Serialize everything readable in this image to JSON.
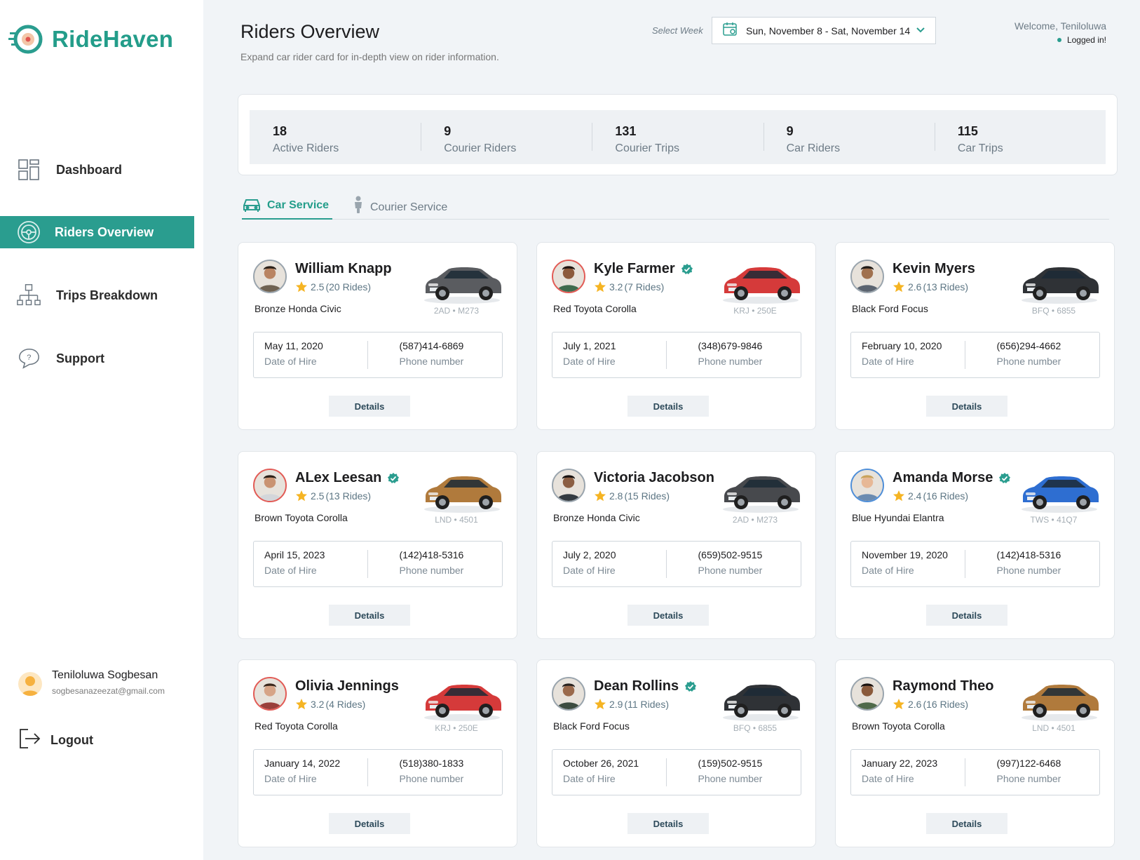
{
  "app": {
    "name": "RideHaven"
  },
  "sidebar": {
    "items": [
      {
        "label": "Dashboard",
        "icon": "dashboard-icon"
      },
      {
        "label": "Riders Overview",
        "icon": "steering-wheel-icon",
        "active": true
      },
      {
        "label": "Trips Breakdown",
        "icon": "hierarchy-icon"
      },
      {
        "label": "Support",
        "icon": "support-chat-icon"
      }
    ],
    "user": {
      "name": "Teniloluwa Sogbesan",
      "email": "sogbesanazeezat@gmail.com"
    },
    "logout_label": "Logout"
  },
  "header": {
    "title": "Riders Overview",
    "subtitle": "Expand car rider card for in-depth view on rider information.",
    "week_label": "Select Week",
    "week_value": "Sun, November 8 - Sat, November 14",
    "welcome": "Welcome, Teniloluwa",
    "status": "Logged in!"
  },
  "stats": [
    {
      "value": "18",
      "label": "Active Riders"
    },
    {
      "value": "9",
      "label": "Courier Riders"
    },
    {
      "value": "131",
      "label": "Courier Trips"
    },
    {
      "value": "9",
      "label": "Car Riders"
    },
    {
      "value": "115",
      "label": "Car Trips"
    }
  ],
  "tabs": [
    {
      "label": "Car Service",
      "active": true
    },
    {
      "label": "Courier Service",
      "active": false
    }
  ],
  "labels": {
    "date_of_hire": "Date of Hire",
    "phone_number": "Phone number",
    "details": "Details"
  },
  "riders": [
    {
      "name": "William Knapp",
      "verified": false,
      "rating": "2.5",
      "rides": "(20 Rides)",
      "car": "Bronze Honda Civic",
      "plate": "2AD • M273",
      "hire_date": "May 11, 2020",
      "phone": "(587)414-6869",
      "car_color": "#5a5c60"
    },
    {
      "name": "Kyle Farmer",
      "verified": true,
      "rating": "3.2",
      "rides": "(7 Rides)",
      "car": "Red Toyota Corolla",
      "plate": "KRJ • 250E",
      "hire_date": "July 1, 2021",
      "phone": "(348)679-9846",
      "car_color": "#d53a3a"
    },
    {
      "name": "Kevin Myers",
      "verified": false,
      "rating": "2.6",
      "rides": "(13 Rides)",
      "car": "Black Ford Focus",
      "plate": "BFQ • 6855",
      "hire_date": "February 10, 2020",
      "phone": "(656)294-4662",
      "car_color": "#2f3236"
    },
    {
      "name": "ALex Leesan",
      "verified": true,
      "rating": "2.5",
      "rides": "(13 Rides)",
      "car": "Brown Toyota Corolla",
      "plate": "LND • 4501",
      "hire_date": "April 15, 2023",
      "phone": "(142)418-5316",
      "car_color": "#b07a3c"
    },
    {
      "name": "Victoria Jacobson",
      "verified": false,
      "rating": "2.8",
      "rides": "(15 Rides)",
      "car": "Bronze Honda Civic",
      "plate": "2AD • M273",
      "hire_date": "July 2, 2020",
      "phone": "(659)502-9515",
      "car_color": "#47494d"
    },
    {
      "name": "Amanda Morse",
      "verified": true,
      "rating": "2.4",
      "rides": "(16 Rides)",
      "car": "Blue Hyundai Elantra",
      "plate": "TWS • 41Q7",
      "hire_date": "November 19, 2020",
      "phone": "(142)418-5316",
      "car_color": "#2e6ed1"
    },
    {
      "name": "Olivia Jennings",
      "verified": false,
      "rating": "3.2",
      "rides": "(4 Rides)",
      "car": "Red Toyota Corolla",
      "plate": "KRJ • 250E",
      "hire_date": "January 14, 2022",
      "phone": "(518)380-1833",
      "car_color": "#d53a3a"
    },
    {
      "name": "Dean Rollins",
      "verified": true,
      "rating": "2.9",
      "rides": "(11 Rides)",
      "car": "Black Ford Focus",
      "plate": "BFQ • 6855",
      "hire_date": "October 26, 2021",
      "phone": "(159)502-9515",
      "car_color": "#2f3236"
    },
    {
      "name": "Raymond Theo",
      "verified": false,
      "rating": "2.6",
      "rides": "(16 Rides)",
      "car": "Brown Toyota Corolla",
      "plate": "LND • 4501",
      "hire_date": "January 22, 2023",
      "phone": "(997)122-6468",
      "car_color": "#b07a3c"
    }
  ],
  "colors": {
    "accent": "#2a9d8f",
    "star": "#f5b423",
    "verified": "#2a9d8f"
  }
}
